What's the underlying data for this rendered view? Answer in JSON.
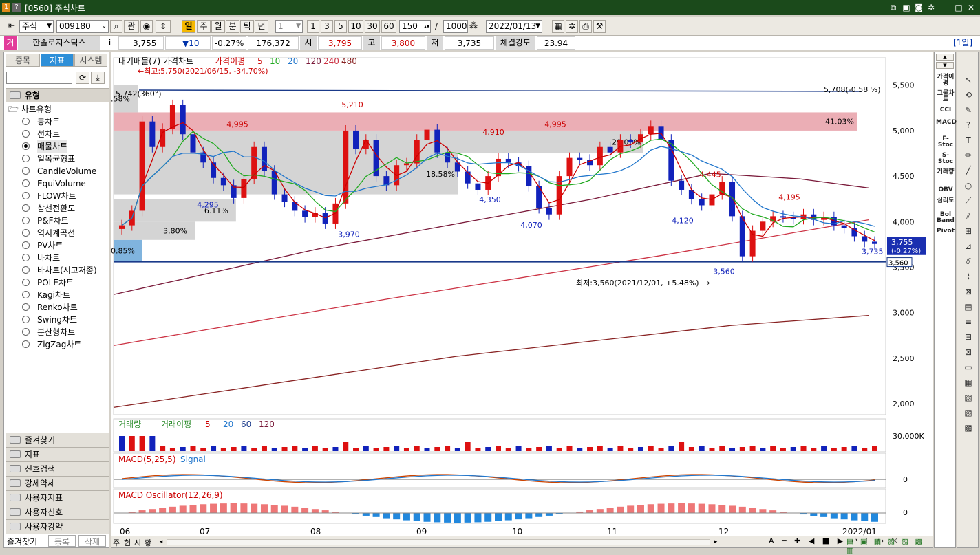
{
  "window": {
    "badge": "[0560]",
    "title": "주식차트"
  },
  "toolbar": {
    "market": "주식",
    "code": "009180",
    "kwan": "관",
    "periods": [
      "일",
      "주",
      "월",
      "분",
      "틱",
      "년"
    ],
    "interval": "1",
    "quick": [
      "1",
      "3",
      "5",
      "10",
      "30",
      "60"
    ],
    "count": "150",
    "sep": "/",
    "max": "1000",
    "date": "2022/01/13"
  },
  "quote": {
    "name": "한솔로지스틱스",
    "i": "i",
    "price": "3,755",
    "change": "▼10",
    "pct": "-0.27%",
    "volume": "176,372",
    "open_l": "시",
    "open": "3,795",
    "high_l": "고",
    "high": "3,800",
    "low_l": "저",
    "low": "3,735",
    "str_l": "체결강도",
    "strength": "23.94",
    "period": "[1일]",
    "badge": "거"
  },
  "left": {
    "tabs": [
      "종목",
      "지표",
      "시스템"
    ],
    "type_header": "유형",
    "tree_root": "차트유형",
    "types": [
      "봉차트",
      "선차트",
      "매물차트",
      "일목균형표",
      "CandleVolume",
      "EquiVolume",
      "FLOW차트",
      "삼선전환도",
      "P&F차트",
      "역시계곡선",
      "PV차트",
      "바차트",
      "바차트(시고저종)",
      "POLE차트",
      "Kagi차트",
      "Renko차트",
      "Swing차트",
      "분산형차트",
      "ZigZag차트"
    ],
    "selected_type": "매물차트",
    "groups": [
      "즐겨찾기",
      "지표",
      "신호검색",
      "강세약세",
      "사용자지표",
      "사용자신호",
      "사용자강약"
    ],
    "bottom_tabs": [
      "즐겨찾기",
      "등록",
      "삭제"
    ]
  },
  "chart_data": [
    {
      "type": "candlestick",
      "title": "대기매물(7)  가격차트",
      "legend": [
        {
          "name": "가격이평",
          "color": "#cc0000"
        },
        {
          "name": "5",
          "color": "#cc0000"
        },
        {
          "name": "10",
          "color": "#22aa22"
        },
        {
          "name": "20",
          "color": "#2277cc"
        },
        {
          "name": "120",
          "color": "#7a1a3a"
        },
        {
          "name": "240",
          "color": "#cc3344"
        },
        {
          "name": "480",
          "color": "#882222"
        }
      ],
      "yticks": [
        "5,500",
        "5,000",
        "4,500",
        "4,000",
        "3,500",
        "3,000",
        "2,500",
        "2,000"
      ],
      "ylim": [
        1880,
        5800
      ],
      "xticks": [
        "06",
        "07",
        "08",
        "09",
        "10",
        "11",
        "12",
        "2022/01"
      ],
      "annotations": {
        "high": "←최고:5,750(2021/06/15, -34.70%)",
        "low": "최저:3,560(2021/12/01, +5.48%)⟶",
        "trend_start": "5,742(360°)",
        "trend_end": "5,708(-0.58 %)",
        "current": "3,755",
        "current_pct": "(-0.27%)",
        "last": "3,735",
        "support": "3,560"
      },
      "peaks": [
        "5,210",
        "4,995",
        "4,910",
        "4,995",
        "4,445",
        "4,195"
      ],
      "troughs": [
        "3,970",
        "4,295",
        "4,350",
        "4,070",
        "4,120",
        "3,560"
      ],
      "volume_profile": [
        {
          "range": [
            3560,
            3800
          ],
          "pct": "0.85%"
        },
        {
          "range": [
            3800,
            4000
          ],
          "pct": "3.80%"
        },
        {
          "range": [
            4000,
            4250
          ],
          "pct": "6.11%"
        },
        {
          "range": [
            4300,
            4750
          ],
          "pct": "18.58%"
        },
        {
          "range": [
            4750,
            5000
          ],
          "pct": "29.03%"
        },
        {
          "range": [
            5000,
            5200
          ],
          "pct": "41.03%"
        },
        {
          "range": [
            5200,
            5500
          ],
          "pct": "0.58%"
        }
      ],
      "close": [
        3960,
        4120,
        5100,
        4820,
        5020,
        5280,
        4960,
        4760,
        4650,
        4480,
        4400,
        4260,
        4470,
        4820,
        4560,
        4300,
        4220,
        4120,
        4050,
        4100,
        3980,
        4200,
        5000,
        4800,
        4900,
        4500,
        4400,
        4620,
        4640,
        4900,
        5010,
        4760,
        4650,
        4550,
        4420,
        4350,
        4500,
        4690,
        4650,
        4610,
        4390,
        4150,
        4080,
        4500,
        4700,
        4680,
        4620,
        4820,
        4760,
        4900,
        4870,
        4960,
        5050,
        4900,
        4450,
        4350,
        4250,
        4180,
        4300,
        4440,
        4060,
        3620,
        3900,
        4000,
        4060,
        4050,
        4030,
        4080,
        4020,
        4050,
        3960,
        3930,
        3840,
        3780,
        3755
      ]
    },
    {
      "type": "bar",
      "title": "거래량",
      "legend": [
        "거래이평",
        "5",
        "20",
        "60",
        "120"
      ],
      "ytick": "30,000K"
    },
    {
      "type": "line",
      "title": "MACD(5,25,5)",
      "legend": [
        "Signal"
      ],
      "ytick": "0"
    },
    {
      "type": "bar",
      "title": "MACD Oscillator(12,26,9)",
      "ytick": "0"
    }
  ],
  "bottom": {
    "tabs": [
      "주",
      "현",
      "시",
      "황"
    ]
  },
  "rightbar": [
    "가격이평",
    "그물차트",
    "CCI",
    "MACD",
    "F-Stoc",
    "S-Stoc",
    "거래량",
    "OBV",
    "심리도",
    "Bol Band",
    "Pivot"
  ]
}
